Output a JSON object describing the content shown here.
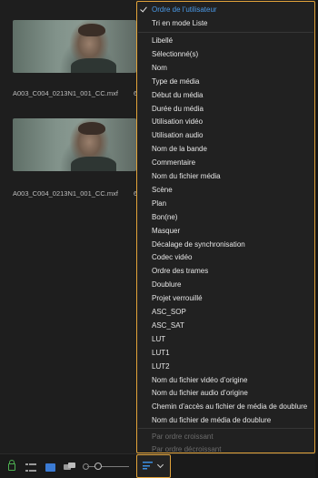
{
  "clips": [
    {
      "name": "A003_C004_0213N1_001_CC.mxf",
      "extra": "6"
    },
    {
      "name": "A003_C004_0213N1_001_CC.mxf",
      "extra": "6"
    }
  ],
  "toolbar": {
    "lock_icon": "lock-icon",
    "list_view_icon": "list-view-icon",
    "icon_view_icon": "icon-view-icon",
    "freeform_view_icon": "freeform-view-icon",
    "sort_icon": "sort-icon",
    "accent_color": "#e2a33a",
    "active_color": "#3b7bd4"
  },
  "menu": {
    "top_items": [
      "Ordre de l’utilisateur",
      "Tri en mode Liste"
    ],
    "columns": [
      "Libellé",
      "Sélectionné(s)",
      "Nom",
      "Type de média",
      "Début du média",
      "Durée du média",
      "Utilisation vidéo",
      "Utilisation audio",
      "Nom de la bande",
      "Commentaire",
      "Nom du fichier média",
      "Scène",
      "Plan",
      "Bon(ne)",
      "Masquer",
      "Décalage de synchronisation",
      "Codec vidéo",
      "Ordre des trames",
      "Doublure",
      "Projet verrouillé",
      "ASC_SOP",
      "ASC_SAT",
      "LUT",
      "LUT1",
      "LUT2",
      "Nom du fichier vidéo d’origine",
      "Nom du fichier audio d’origine",
      "Chemin d’accès au fichier de média de doublure",
      "Nom du fichier de média de doublure"
    ],
    "order_items": [
      "Par ordre croissant",
      "Par ordre décroissant"
    ],
    "checked_color": "#4a9ae8"
  }
}
